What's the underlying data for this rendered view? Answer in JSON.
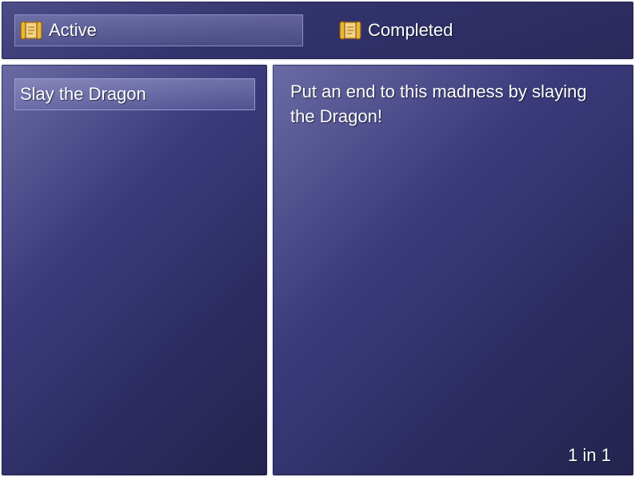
{
  "tabs": [
    {
      "label": "Active",
      "icon": "scroll-icon",
      "selected": true
    },
    {
      "label": "Completed",
      "icon": "scroll-icon",
      "selected": false
    }
  ],
  "quest_list": {
    "items": [
      {
        "label": "Slay the Dragon",
        "selected": true
      }
    ]
  },
  "detail": {
    "description": "Put an end to this madness by slaying the Dragon!",
    "page_counter": "1 in 1"
  },
  "colors": {
    "window_dark": "#2c2c62",
    "window_light": "#6a6aa4",
    "border": "#f3f3f8",
    "scroll_gold": "#e8b83a"
  }
}
